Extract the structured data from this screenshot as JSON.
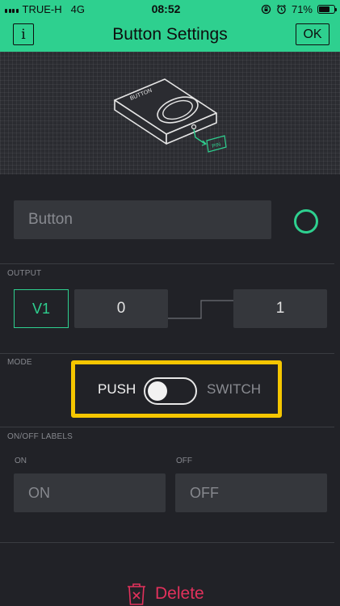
{
  "status_bar": {
    "carrier": "TRUE-H",
    "network": "4G",
    "time": "08:52",
    "battery_text": "71%",
    "battery_level": 0.71
  },
  "header": {
    "title": "Button Settings",
    "info_label": "i",
    "ok_label": "OK"
  },
  "preview": {
    "widget_label": "BUTTON",
    "pin_label": "PIN"
  },
  "name_field": {
    "value": "Button"
  },
  "colors": {
    "accent": "#2ed08f",
    "highlight": "#f5c600",
    "danger": "#e2315c",
    "background": "#212227",
    "field": "#35373c"
  },
  "output": {
    "label": "OUTPUT",
    "pin": "V1",
    "min": "0",
    "max": "1"
  },
  "mode": {
    "label": "MODE",
    "push": "PUSH",
    "switch": "SWITCH"
  },
  "labels": {
    "section": "ON/OFF LABELS",
    "on_label": "ON",
    "off_label": "OFF",
    "on_value": "ON",
    "off_value": "OFF"
  },
  "delete_label": "Delete"
}
